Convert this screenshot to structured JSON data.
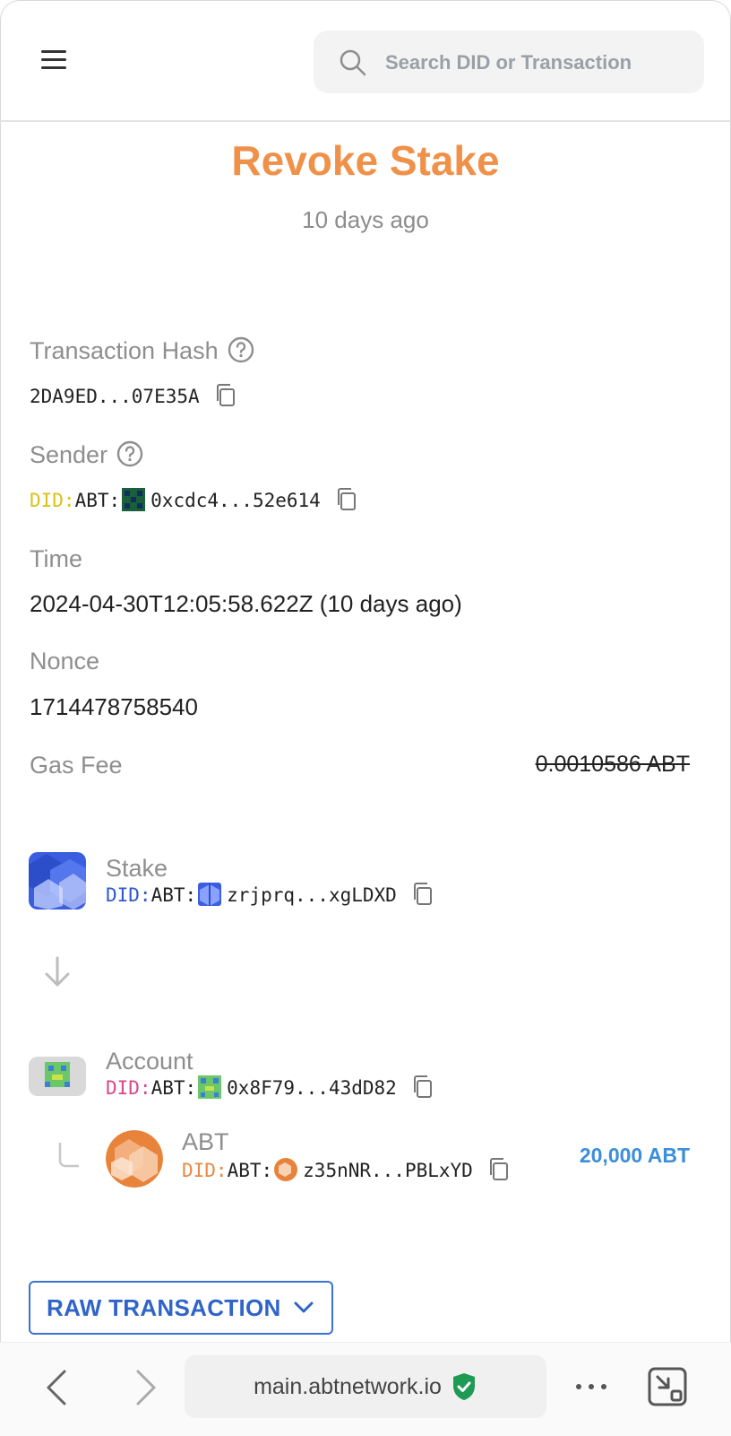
{
  "header": {
    "menu_icon": "hamburger-menu-icon",
    "search": {
      "placeholder": "Search DID or Transaction",
      "icon": "search-icon"
    }
  },
  "page": {
    "title": "Revoke Stake",
    "subtitle": "10 days ago",
    "title_color": "#f0914a"
  },
  "fields": {
    "tx_hash": {
      "label": "Transaction Hash",
      "value": "2DA9ED...07E35A"
    },
    "sender": {
      "label": "Sender",
      "did_prefix": "DID:",
      "did_type": "ABT:",
      "value": "0xcdc4...52e614"
    },
    "time": {
      "label": "Time",
      "value": "2024-04-30T12:05:58.622Z (10 days ago)"
    },
    "nonce": {
      "label": "Nonce",
      "value": "1714478758540"
    },
    "gas_fee": {
      "label": "Gas Fee",
      "value": "0.0010586 ABT"
    }
  },
  "flow": {
    "from": {
      "title": "Stake",
      "did_prefix": "DID:",
      "did_type": "ABT:",
      "address": "zrjprq...xgLDXD"
    },
    "to": {
      "title": "Account",
      "did_prefix": "DID:",
      "did_type": "ABT:",
      "address": "0x8F79...43dD82"
    },
    "token": {
      "title": "ABT",
      "did_prefix": "DID:",
      "did_type": "ABT:",
      "address": "z35nNR...PBLxYD",
      "amount": "20,000 ABT"
    }
  },
  "raw_button": {
    "label": "RAW TRANSACTION"
  },
  "browser": {
    "url": "main.abtnetwork.io",
    "secure_icon": "verified-shield-icon",
    "accent": "#3a8edb"
  }
}
